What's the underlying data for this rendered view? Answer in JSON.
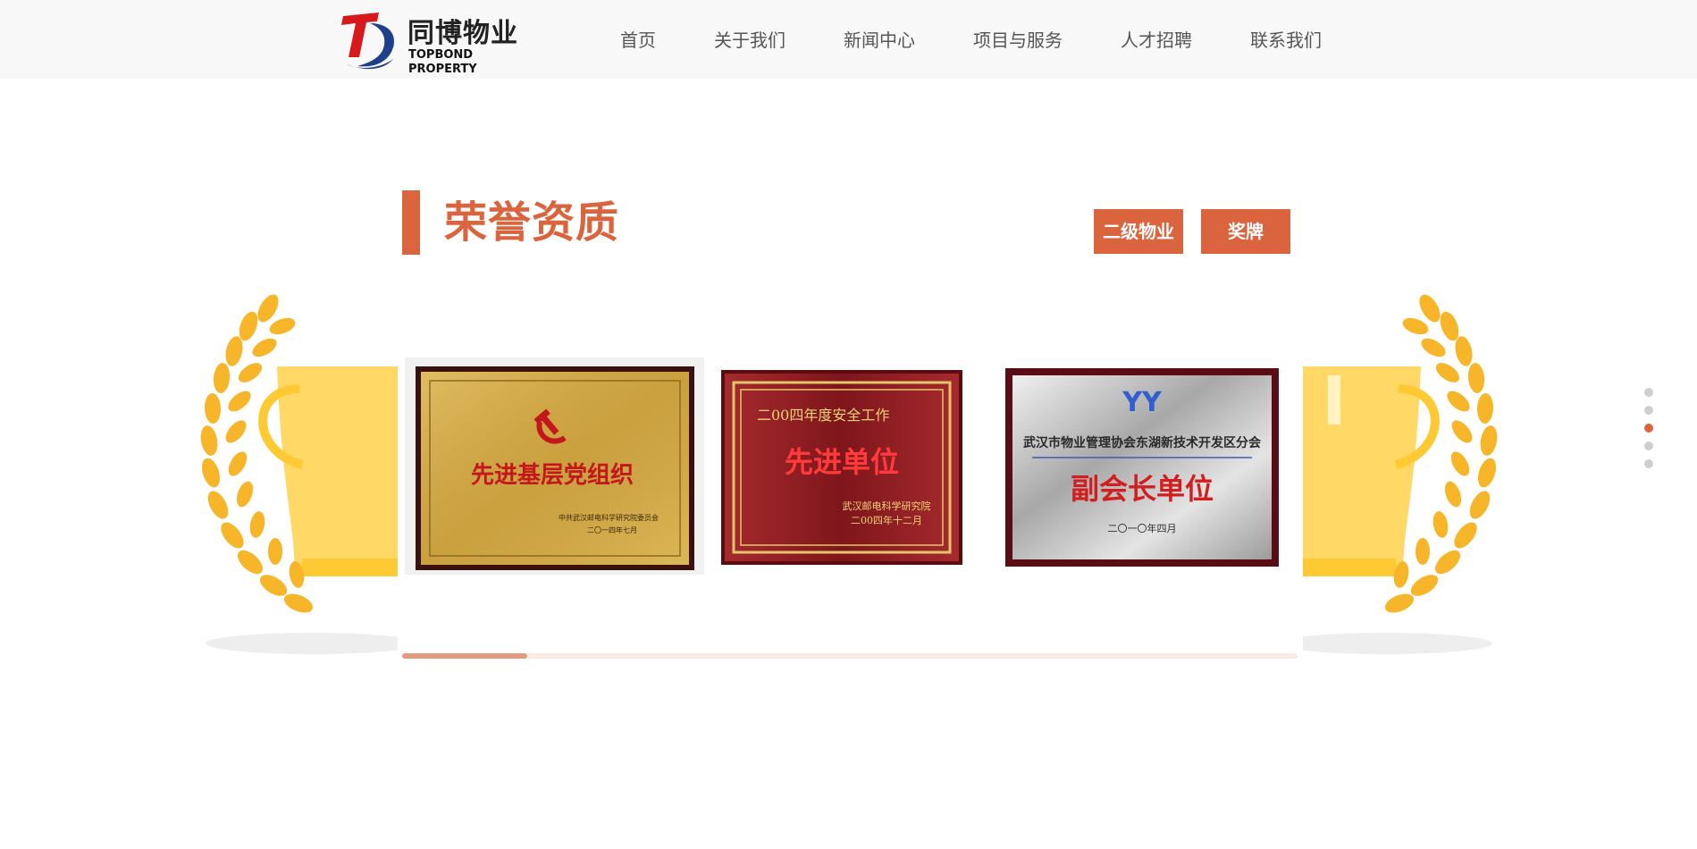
{
  "header": {
    "logo": {
      "mark_letter": "T",
      "name_cn": "同博物业",
      "name_en": "TOPBOND PROPERTY"
    },
    "nav": [
      {
        "label": "首页"
      },
      {
        "label": "关于我们"
      },
      {
        "label": "新闻中心"
      },
      {
        "label": "项目与服务"
      },
      {
        "label": "人才招聘"
      },
      {
        "label": "联系我们"
      }
    ]
  },
  "section": {
    "title": "荣誉资质",
    "tabs": [
      {
        "label": "二级物业"
      },
      {
        "label": "奖牌"
      }
    ]
  },
  "plaques": [
    {
      "style": "gold",
      "title": "先进基层党组织",
      "issuer": "中共武汉邮电科学研究院委员会",
      "date": "二〇一四年七月"
    },
    {
      "style": "red",
      "heading": "二00四年度安全工作",
      "title": "先进单位",
      "issuer": "武汉邮电科学研究院",
      "date": "二00四年十二月"
    },
    {
      "style": "silver",
      "org_logo": "YY",
      "heading": "武汉市物业管理协会东湖新技术开发区分会",
      "title": "副会长单位",
      "date": "二〇一〇年四月"
    }
  ],
  "slider": {
    "progress": 0.14,
    "page_count": 5,
    "active_page": 3
  },
  "colors": {
    "accent": "#d9643d",
    "progress_fill": "#e59a80",
    "progress_track": "#fbeae4",
    "trophy_gold": "#f7b52a"
  },
  "icons": {
    "trophy": "laurel-trophy-icon",
    "logo": "topbond-logo-icon"
  }
}
